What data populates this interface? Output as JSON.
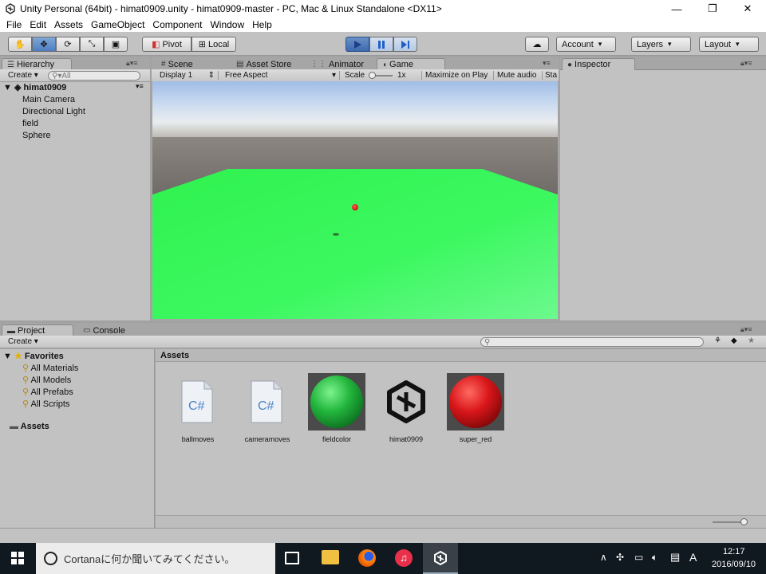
{
  "window": {
    "title": "Unity Personal (64bit) - himat0909.unity - himat0909-master - PC, Mac & Linux Standalone <DX11>",
    "controls": [
      "—",
      "❐",
      "✕"
    ]
  },
  "menu": [
    "File",
    "Edit",
    "Assets",
    "GameObject",
    "Component",
    "Window",
    "Help"
  ],
  "toolbar": {
    "pivot": "Pivot",
    "local": "Local",
    "account": "Account",
    "layers": "Layers",
    "layout": "Layout"
  },
  "hierarchy": {
    "tab": "Hierarchy",
    "create": "Create",
    "search_placeholder": "All",
    "scene": "himat0909",
    "items": [
      "Main Camera",
      "Directional Light",
      "field",
      "Sphere"
    ]
  },
  "center_tabs": [
    "Scene",
    "Asset Store",
    "Animator",
    "Game"
  ],
  "game_bar": {
    "display": "Display 1",
    "aspect": "Free Aspect",
    "scale_label": "Scale",
    "scale_value": "1x",
    "maximize": "Maximize on Play",
    "mute": "Mute audio",
    "stats": "Sta"
  },
  "inspector": {
    "tab": "Inspector"
  },
  "bottom_tabs": [
    "Project",
    "Console"
  ],
  "project": {
    "create": "Create",
    "favorites": "Favorites",
    "favorite_items": [
      "All Materials",
      "All Models",
      "All Prefabs",
      "All Scripts"
    ],
    "assets_root": "Assets",
    "assets_header": "Assets",
    "assets": [
      {
        "name": "ballmoves",
        "kind": "script"
      },
      {
        "name": "cameramoves",
        "kind": "script"
      },
      {
        "name": "fieldcolor",
        "kind": "material-green"
      },
      {
        "name": "himat0909",
        "kind": "unity-scene"
      },
      {
        "name": "super_red",
        "kind": "material-red"
      }
    ]
  },
  "taskbar": {
    "cortana": "Cortanaに何か聞いてみてください。",
    "time": "12:17",
    "date": "2016/09/10",
    "ime": "A"
  },
  "colors": {
    "field_green": "#33ff55",
    "ball_red": "#ff2020",
    "play_blue": "#4e7fc2"
  }
}
